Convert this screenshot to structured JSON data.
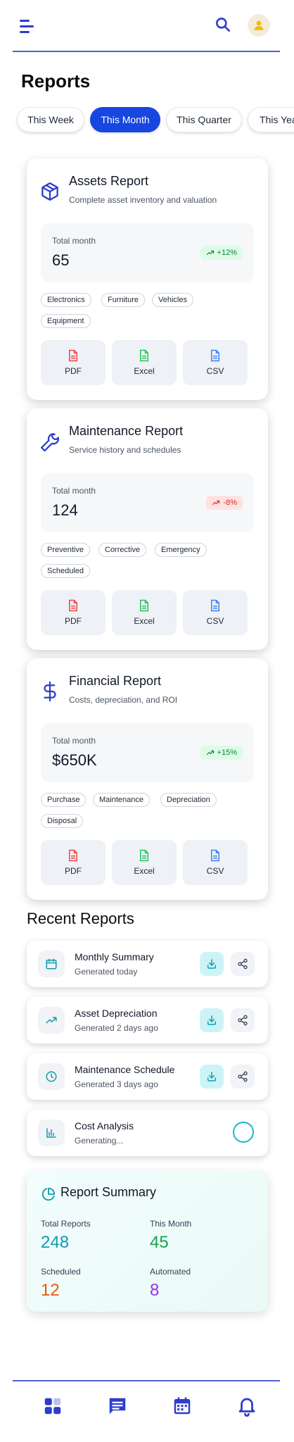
{
  "page": {
    "title": "Reports"
  },
  "period_tabs": [
    "This Week",
    "This Month",
    "This Quarter",
    "This Year"
  ],
  "active_tab": "This Month",
  "report_cards": [
    {
      "title": "Assets Report",
      "subtitle": "Complete asset inventory and valuation",
      "icon": "cube-icon",
      "metric_label": "Total month",
      "metric_value": "65",
      "trend": "+12%",
      "trend_dir": "up",
      "tags": [
        "Electronics",
        "Furniture",
        "Vehicles",
        "Equipment"
      ]
    },
    {
      "title": "Maintenance Report",
      "subtitle": "Service history and schedules",
      "icon": "wrench-icon",
      "metric_label": "Total month",
      "metric_value": "124",
      "trend": "-8%",
      "trend_dir": "down",
      "tags": [
        "Preventive",
        "Corrective",
        "Emergency",
        "Scheduled"
      ]
    },
    {
      "title": "Financial Report",
      "subtitle": "Costs, depreciation, and ROI",
      "icon": "dollar-icon",
      "metric_label": "Total month",
      "metric_value": "$650K",
      "trend": "+15%",
      "trend_dir": "up",
      "tags": [
        "Purchase",
        "Maintenance",
        "Depreciation",
        "Disposal"
      ]
    }
  ],
  "export_options": [
    "PDF",
    "Excel",
    "CSV"
  ],
  "recent_reports": {
    "title": "Recent Reports",
    "items": [
      {
        "title": "Monthly Summary",
        "status": "Generated today",
        "icon": "calendar-icon"
      },
      {
        "title": "Asset Depreciation",
        "status": "Generated 2 days ago",
        "icon": "trending-up-icon"
      },
      {
        "title": "Maintenance Schedule",
        "status": "Generated 3 days ago",
        "icon": "clock-icon"
      },
      {
        "title": "Cost Analysis",
        "status": "Generating...",
        "icon": "bar-chart-icon"
      }
    ]
  },
  "summary": {
    "title": "Report Summary",
    "stats": [
      {
        "label": "Total Reports",
        "value": "248",
        "color": "#0e9bb0"
      },
      {
        "label": "This Month",
        "value": "45",
        "color": "#16a34a"
      },
      {
        "label": "Scheduled",
        "value": "12",
        "color": "#ea580c"
      },
      {
        "label": "Automated",
        "value": "8",
        "color": "#9333ea"
      }
    ]
  },
  "colors": {
    "primary": "#1746e0",
    "accent_teal": "#14b8c8",
    "pdf": "#ef4444",
    "excel": "#22c55e",
    "csv": "#3b82f6"
  }
}
